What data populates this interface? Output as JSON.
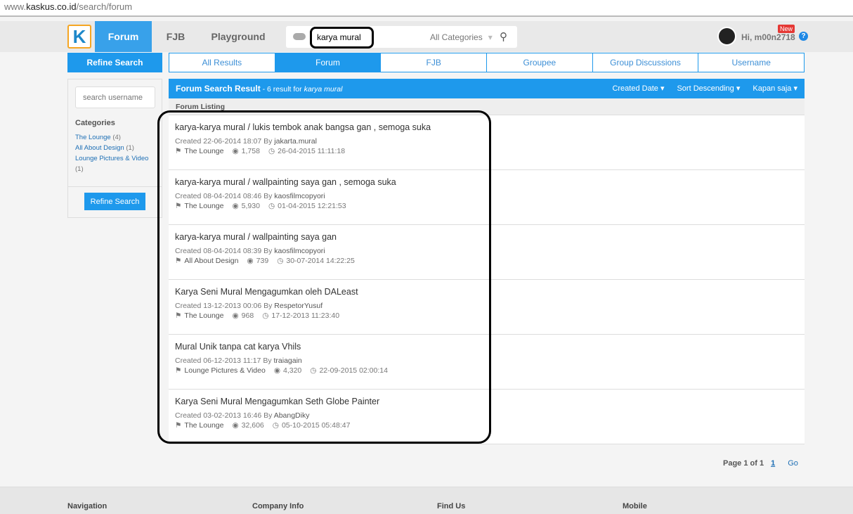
{
  "browser": {
    "url_prefix": "www.",
    "url_domain": "kaskus.co.id",
    "url_path": "/search/forum"
  },
  "header": {
    "logo": "K",
    "nav": [
      "Forum",
      "FJB",
      "Playground"
    ],
    "search_value": "karya mural",
    "category": "All Categories",
    "user": "Hi, m00n2718",
    "new_badge": "New",
    "help": "?"
  },
  "sidebar": {
    "title": "Refine Search",
    "username_placeholder": "search username",
    "categories_title": "Categories",
    "categories": [
      {
        "name": "The Lounge",
        "count": "(4)"
      },
      {
        "name": "All About Design",
        "count": "(1)"
      },
      {
        "name": "Lounge Pictures & Video",
        "count": "(1)"
      }
    ],
    "button": "Refine Search"
  },
  "tabs": [
    "All Results",
    "Forum",
    "FJB",
    "Groupee",
    "Group Discussions",
    "Username"
  ],
  "results_header": {
    "title": "Forum Search Result",
    "count_text": " - 6 result for ",
    "query": "karya mural",
    "sort_by": "Created Date",
    "order": "Sort Descending",
    "time": "Kapan saja",
    "listing": "Forum Listing"
  },
  "results": [
    {
      "title": "karya-karya mural / lukis tembok anak bangsa gan , semoga suka",
      "created": "Created 22-06-2014 18:07 By ",
      "author": "jakarta.mural",
      "category": "The Lounge",
      "views": "1,758",
      "last": "26-04-2015 11:11:18"
    },
    {
      "title": "karya-karya mural / wallpainting saya gan , semoga suka",
      "created": "Created 08-04-2014 08:46 By ",
      "author": "kaosfilmcopyori",
      "category": "The Lounge",
      "views": "5,930",
      "last": "01-04-2015 12:21:53"
    },
    {
      "title": "karya-karya mural / wallpainting saya gan",
      "created": "Created 08-04-2014 08:39 By ",
      "author": "kaosfilmcopyori",
      "category": "All About Design",
      "views": "739",
      "last": "30-07-2014 14:22:25"
    },
    {
      "title": "Karya Seni Mural Mengagumkan oleh DALeast",
      "created": "Created 13-12-2013 00:06 By ",
      "author": "RespetorYusuf",
      "category": "The Lounge",
      "views": "968",
      "last": "17-12-2013 11:23:40"
    },
    {
      "title": "Mural Unik tanpa cat karya Vhils",
      "created": "Created 06-12-2013 11:17 By ",
      "author": "traiagain",
      "category": "Lounge Pictures & Video",
      "views": "4,320",
      "last": "22-09-2015 02:00:14"
    },
    {
      "title": "Karya Seni Mural Mengagumkan Seth Globe Painter",
      "created": "Created 03-02-2013 16:46 By ",
      "author": "AbangDiky",
      "category": "The Lounge",
      "views": "32,606",
      "last": "05-10-2015 05:48:47"
    }
  ],
  "pager": {
    "label": "Page 1 of 1",
    "page": "1",
    "go": "Go"
  },
  "footer": [
    "Navigation",
    "Company Info",
    "Find Us",
    "Mobile"
  ],
  "colors": {
    "accent": "#1e99ec",
    "logo_border": "#f5a623",
    "badge": "#e53935"
  }
}
